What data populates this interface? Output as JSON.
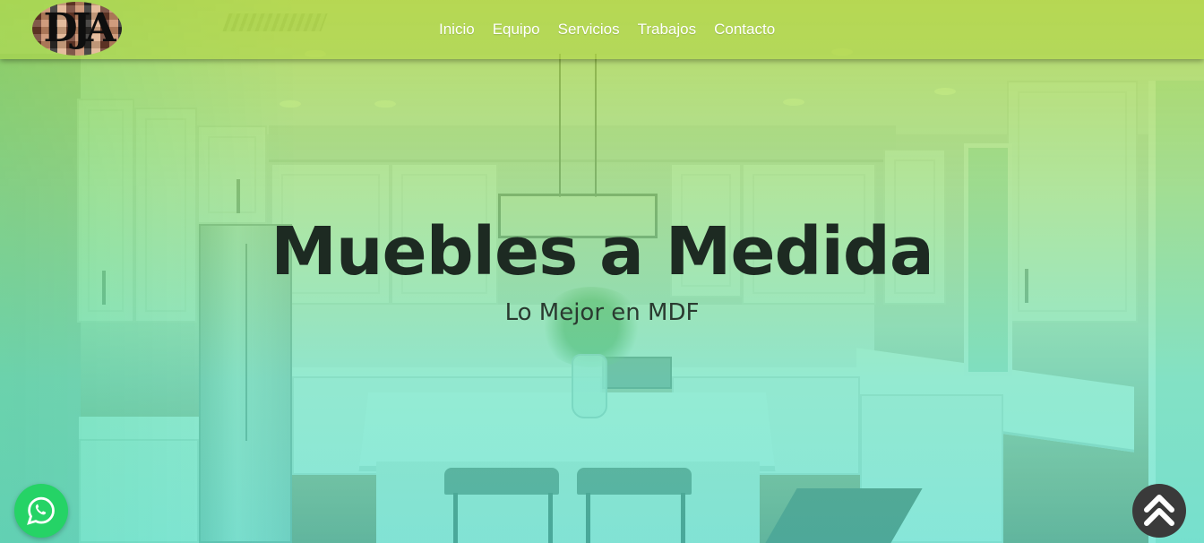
{
  "nav": {
    "logo_text": "DJA",
    "links": [
      {
        "label": "Inicio"
      },
      {
        "label": "Equipo"
      },
      {
        "label": "Servicios"
      },
      {
        "label": "Trabajos"
      },
      {
        "label": "Contacto"
      }
    ]
  },
  "hero": {
    "title": "Muebles a Medida",
    "subtitle": "Lo Mejor en MDF"
  },
  "floating": {
    "whatsapp_icon": "whatsapp-icon",
    "scroll_top_icon": "double-chevron-up-icon"
  },
  "colors": {
    "overlay_top": "#acd634",
    "overlay_bottom": "#46e1cd",
    "whatsapp_green": "#25d366",
    "scroll_button": "#3a3a3a",
    "title_text": "#1d2a22"
  }
}
